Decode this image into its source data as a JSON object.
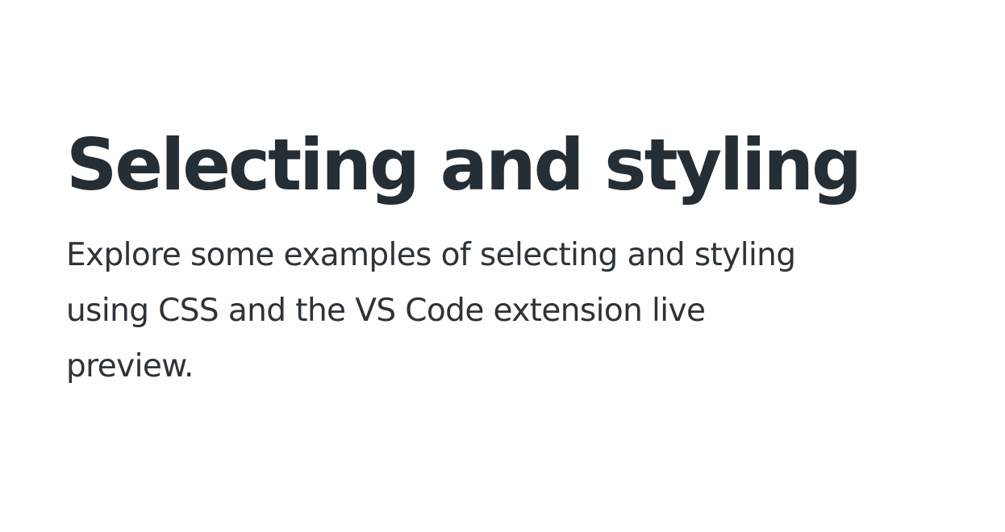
{
  "slide": {
    "title": "Selecting and styling",
    "subtitle": "Explore some examples of selecting and styling using CSS and the VS Code extension live preview."
  },
  "colors": {
    "background": "#fefefe",
    "title": "#252d35",
    "subtitle": "#2c3339"
  }
}
